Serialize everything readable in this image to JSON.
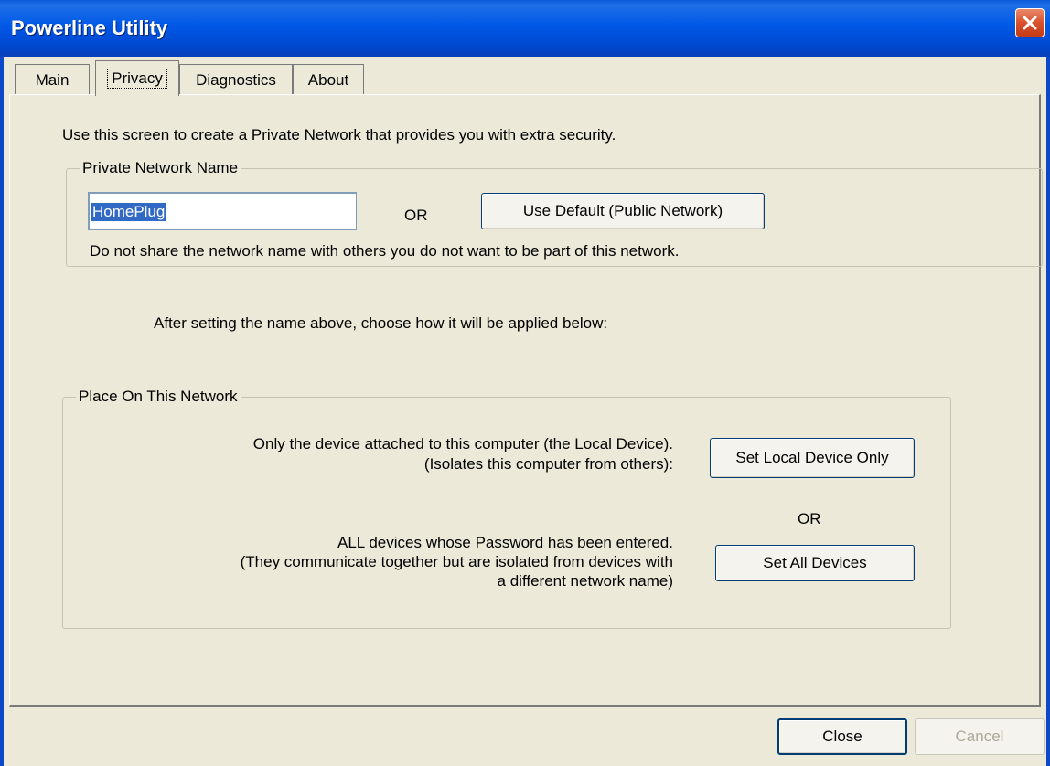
{
  "window": {
    "title": "Powerline Utility"
  },
  "tabs": [
    {
      "label": "Main"
    },
    {
      "label": "Privacy"
    },
    {
      "label": "Diagnostics"
    },
    {
      "label": "About"
    }
  ],
  "privacy": {
    "intro": "Use this screen to create a Private Network that provides you with extra security.",
    "network_name_group": {
      "legend": "Private Network Name",
      "name_value": "HomePlug",
      "or_label": "OR",
      "use_default_label": "Use Default (Public Network)",
      "warning": "Do not share the network name with others you do not want to be part of this network."
    },
    "apply_instruction": "After setting the name above, choose how it will be applied below:",
    "place_group": {
      "legend": "Place On This Network",
      "local_line1": "Only the device attached to this computer (the Local Device).",
      "local_line2": "(Isolates this computer from others):",
      "set_local_label": "Set Local Device Only",
      "or_label": "OR",
      "all_line1": "ALL devices whose Password has been entered.",
      "all_line2": "(They communicate together but are isolated from devices with",
      "all_line3": "a different network name)",
      "set_all_label": "Set All Devices"
    }
  },
  "footer": {
    "close_label": "Close",
    "cancel_label": "Cancel"
  }
}
